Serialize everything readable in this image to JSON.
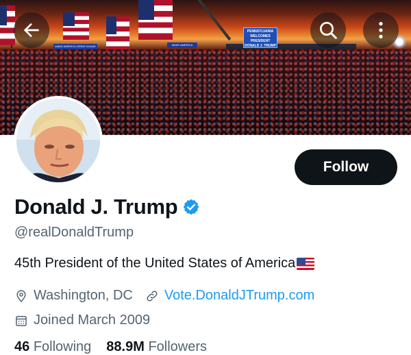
{
  "header": {
    "back_icon": "arrow-left-icon",
    "search_icon": "search-icon",
    "more_icon": "more-vertical-icon"
  },
  "banner": {
    "sign_text": "PENNSYLVANIA WELCOMES PRESIDENT DONALD J. TRUMP",
    "strip_text": "MAKE AMERICA GREAT AGAIN!"
  },
  "profile": {
    "display_name": "Donald J. Trump",
    "handle": "@realDonaldTrump",
    "bio": "45th President of the United States of America",
    "location": "Washington, DC",
    "website": "Vote.DonaldJTrump.com",
    "joined": "Joined March 2009",
    "follow_label": "Follow",
    "following_count": "46",
    "following_label": "Following",
    "followers_count": "88.9M",
    "followers_label": "Followers"
  },
  "colors": {
    "accent": "#1d9bf0",
    "text": "#0f1419",
    "muted": "#536471",
    "button": "#0f1419"
  }
}
